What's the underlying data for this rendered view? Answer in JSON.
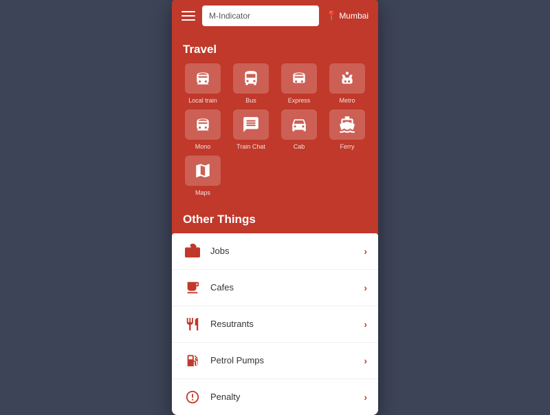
{
  "header": {
    "app_name": "M-Indicator",
    "location": "Mumbai"
  },
  "travel": {
    "section_title": "Travel",
    "items": [
      {
        "label": "Local train",
        "icon": "train"
      },
      {
        "label": "Bus",
        "icon": "bus"
      },
      {
        "label": "Express",
        "icon": "express"
      },
      {
        "label": "Metro",
        "icon": "metro"
      },
      {
        "label": "Mono",
        "icon": "mono"
      },
      {
        "label": "Train Chat",
        "icon": "chat"
      },
      {
        "label": "Cab",
        "icon": "cab"
      },
      {
        "label": "Ferry",
        "icon": "ferry"
      },
      {
        "label": "Maps",
        "icon": "maps"
      }
    ]
  },
  "other_things": {
    "section_title": "Other Things",
    "items": [
      {
        "label": "Jobs",
        "icon": "jobs"
      },
      {
        "label": "Cafes",
        "icon": "cafes"
      },
      {
        "label": "Resutrants",
        "icon": "restaurants"
      },
      {
        "label": "Petrol Pumps",
        "icon": "petrol"
      },
      {
        "label": "Penalty",
        "icon": "penalty"
      }
    ]
  },
  "icons": {
    "hamburger": "☰",
    "pin": "📍",
    "chevron": "›"
  }
}
